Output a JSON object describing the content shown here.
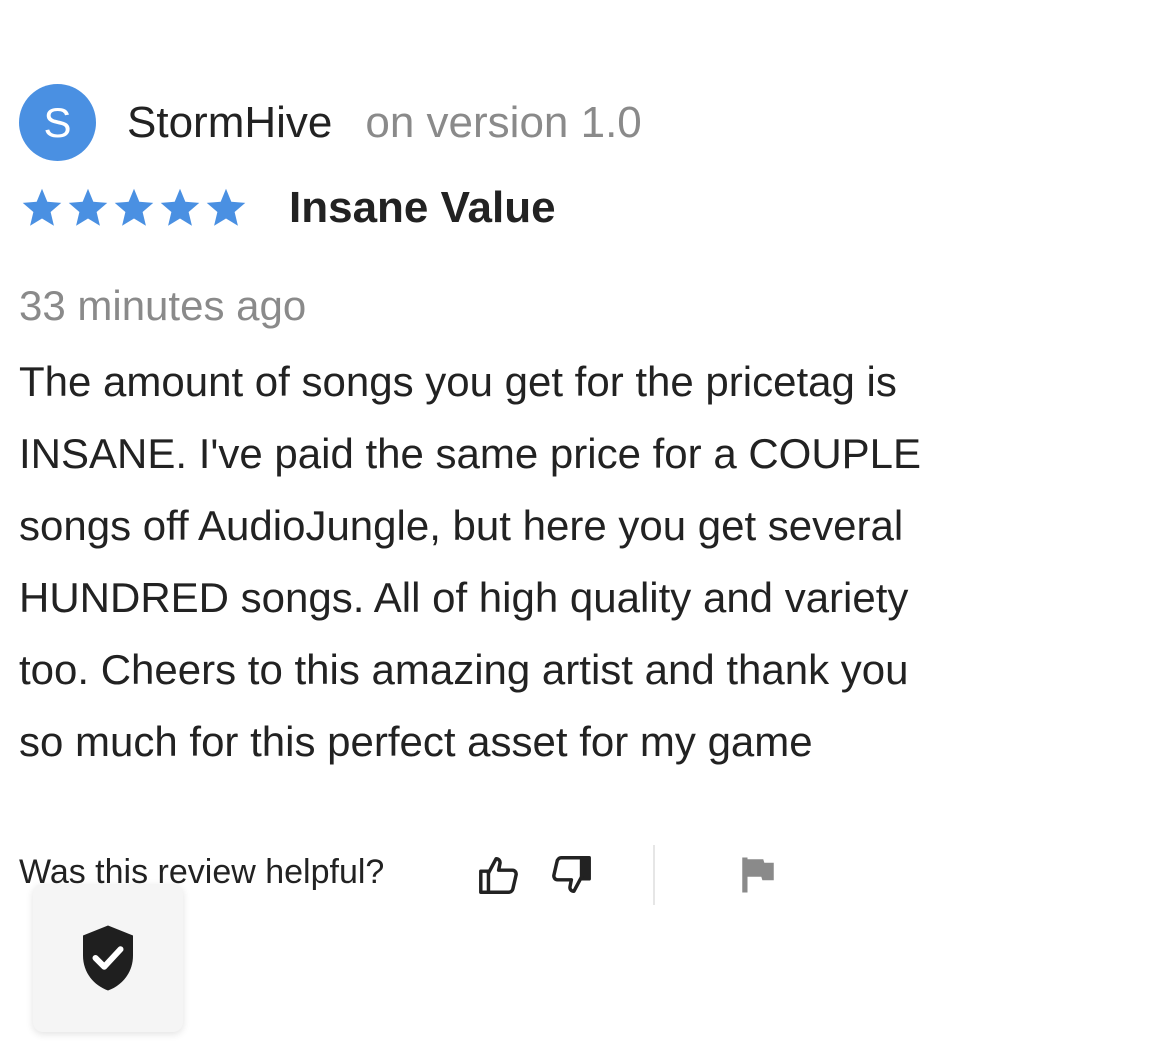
{
  "reviewer": {
    "avatar_initial": "S",
    "name": "StormHive",
    "version_text": "on version 1.0",
    "avatar_color": "#4a90e2"
  },
  "review": {
    "rating": 5,
    "rating_max": 5,
    "star_color": "#4a90e2",
    "title": "Insane Value",
    "timestamp": "33 minutes ago",
    "body_lines": [
      "The amount of songs you get for the pricetag is",
      "INSANE.  I've paid the same price for a COUPLE",
      "songs off AudioJungle, but here you get several",
      "HUNDRED songs.  All of high quality and variety",
      "too.  Cheers to this amazing artist and thank you",
      "so much for this perfect asset for my game"
    ]
  },
  "feedback": {
    "helpful_label": "Was this review helpful?",
    "thumbs_up_icon": "thumbs-up-icon",
    "thumbs_down_icon": "thumbs-down-icon",
    "report_icon": "flag-icon"
  },
  "security_badge": {
    "icon": "shield-check-icon"
  }
}
